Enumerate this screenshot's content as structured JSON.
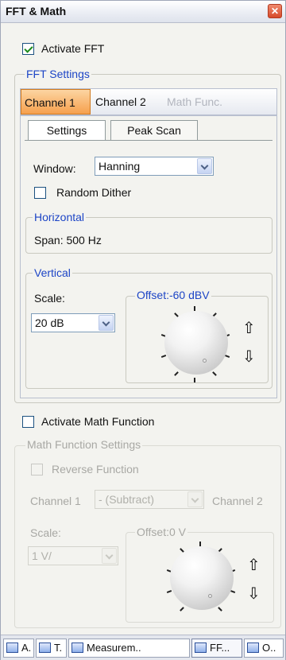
{
  "window": {
    "title": "FFT & Math",
    "close_glyph": "✕"
  },
  "fft": {
    "activate_label": "Activate FFT",
    "activate_checked": true,
    "settings_group_label": "FFT Settings",
    "channel_tabs": [
      "Channel 1",
      "Channel 2",
      "Math Func."
    ],
    "sub_tabs": [
      "Settings",
      "Peak Scan"
    ],
    "window_label": "Window:",
    "window_value": "Hanning",
    "random_dither_label": "Random Dither",
    "horizontal_label": "Horizontal",
    "span_text": "Span: 500 Hz",
    "vertical_label": "Vertical",
    "scale_label": "Scale:",
    "scale_value": "20 dB",
    "offset_label": "Offset:-60 dBV",
    "up_glyph": "⇧",
    "down_glyph": "⇩"
  },
  "math": {
    "activate_label": "Activate Math Function",
    "activate_checked": false,
    "settings_group_label": "Math Function Settings",
    "reverse_label": "Reverse Function",
    "channel1_label": "Channel 1",
    "operation_value": "- (Subtract)",
    "channel2_label": "Channel 2",
    "scale_label": "Scale:",
    "scale_value": "1 V/",
    "offset_label": "Offset:0 V",
    "up_glyph": "⇧",
    "down_glyph": "⇩"
  },
  "bottom_tabs": [
    "A.",
    "T.",
    "Measurem..",
    "FF...",
    "O.."
  ],
  "colors": {
    "accent_blue": "#1d45c6",
    "active_tab_orange": "#f6a04d",
    "title_bg": "#e9ecf3"
  }
}
